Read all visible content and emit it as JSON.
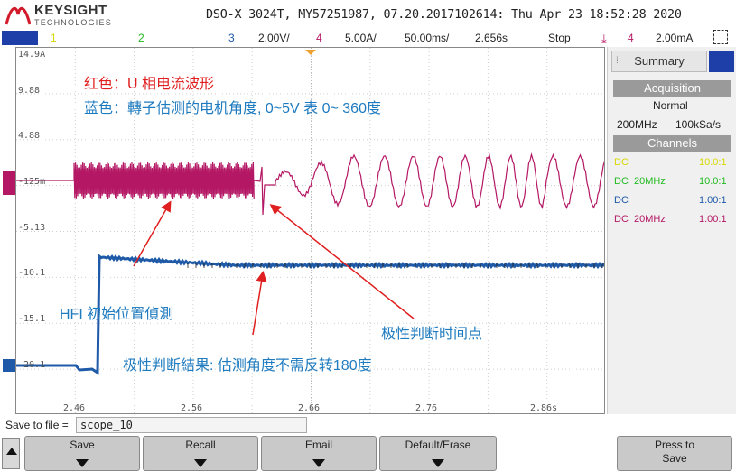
{
  "header": {
    "brand": "KEYSIGHT",
    "brand_sub": "TECHNOLOGIES",
    "info": "DSO-X 3024T, MY57251987, 07.20.2017102614: Thu Apr 23 18:52:28 2020"
  },
  "channel_bar": {
    "ch1": "1",
    "ch2": "2",
    "ch3": "3",
    "ch3_scale": "2.00V/",
    "ch4": "4",
    "ch4_scale": "5.00A/",
    "timebase": "50.00ms/",
    "delay": "2.656s",
    "run_state": "Stop",
    "trigger_ch": "4",
    "trigger_level": "2.00mA"
  },
  "plot": {
    "y_labels": [
      "14.9A",
      "9.88",
      "4.88",
      "-125m",
      "-5.13",
      "-10.1",
      "-15.1",
      "-20.1"
    ],
    "x_labels": [
      "2.46",
      "2.56",
      "2.66",
      "2.76",
      "2.86s"
    ],
    "colors": {
      "ch4": "#b41764",
      "ch3": "#1f5aa8",
      "annotation_red": "#e02020",
      "annotation_blue": "#1f7bbf"
    },
    "annotations": {
      "red_line": "红色：U 相电流波形",
      "blue_line": "蓝色：轉子估测的电机角度, 0~5V 表 0~ 360度",
      "hfi": "HFI 初始位置偵測",
      "polarity_point": "极性判断时间点",
      "polarity_result": "极性判断結果: 估测角度不需反转180度"
    }
  },
  "right_panel": {
    "tab_label": "Summary",
    "acquisition_header": "Acquisition",
    "acq_mode": "Normal",
    "bandwidth": "200MHz",
    "sample_rate": "100kSa/s",
    "channels_header": "Channels",
    "channels": [
      {
        "coupling": "DC",
        "bw": "",
        "probe": "10.0:1",
        "color": "#d8d800"
      },
      {
        "coupling": "DC",
        "bw": "20MHz",
        "probe": "10.0:1",
        "color": "#22bb22"
      },
      {
        "coupling": "DC",
        "bw": "",
        "probe": "1.00:1",
        "color": "#1f5aa8"
      },
      {
        "coupling": "DC",
        "bw": "20MHz",
        "probe": "1.00:1",
        "color": "#b41764"
      }
    ]
  },
  "bottom": {
    "save_label": "Save to file =",
    "save_value": "scope_10",
    "softkeys": [
      "Save",
      "Recall",
      "Email",
      "Default/Erase"
    ],
    "press_to_save": [
      "Press to",
      "Save"
    ]
  }
}
